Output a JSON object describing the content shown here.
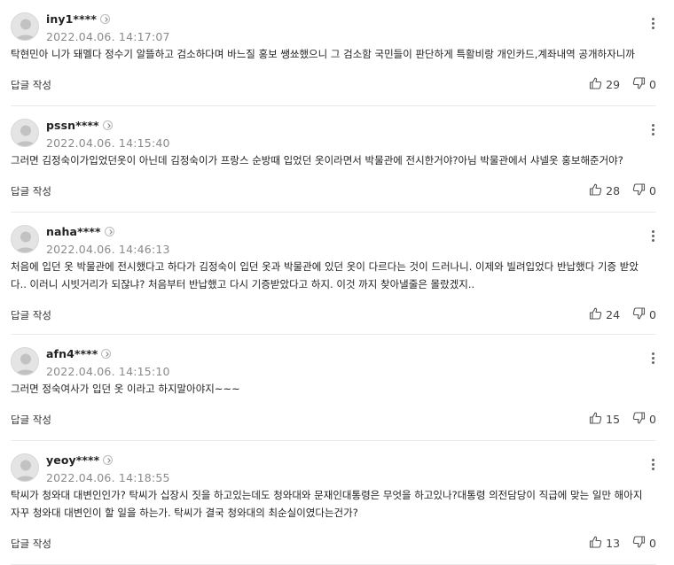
{
  "reply_label": "답글 작성",
  "comments": [
    {
      "user": "iny1****",
      "date": "2022.04.06. 14:17:07",
      "lines": [
        "탁현민아 니가 돼멜다 정수기 알뜰하고 검소하다며 바느질 홍보 쌩쑈했으니 그 검소함 국민들이 판단하게 특활비랑 개인카드,계좌내역 공개하자니까"
      ],
      "likes": "29",
      "dislikes": "0"
    },
    {
      "user": "pssn****",
      "date": "2022.04.06. 14:15:40",
      "lines": [
        "그러면 김정숙이가입었던옷이 아닌데 김정숙이가 프랑스 순방때 입었던 옷이라면서 박물관에 전시한거야?아님 박물관에서 샤넬옷 홍보해준거야?"
      ],
      "likes": "28",
      "dislikes": "0"
    },
    {
      "user": "naha****",
      "date": "2022.04.06. 14:46:13",
      "lines": [
        "처음에 입던 옷 박물관에 전시했다고 하다가 김정숙이 입던 옷과 박물관에 있던 옷이 다르다는 것이 드러나니. 이제와 빌려입었다 반납했다 기증 받았",
        "다.. 이러니 시빗거리가 되잖냐? 처음부터 반납했고 다시 기증받았다고 하지. 이것 까지 찾아낼줄은 몰랐겠지.."
      ],
      "likes": "24",
      "dislikes": "0"
    },
    {
      "user": "afn4****",
      "date": "2022.04.06. 14:15:10",
      "lines": [
        "그러면 정숙여사가 입던 옷 이라고 하지말아야지~~~"
      ],
      "likes": "15",
      "dislikes": "0"
    },
    {
      "user": "yeoy****",
      "date": "2022.04.06. 14:18:55",
      "lines": [
        "탁씨가 청와대 대변인인가? 탁씨가 십장시 짓을 하고있는데도 청와대와 문재인대통령은 무엇을 하고있나?대통령 의전담당이 직급에 맞는 일만 해아지",
        "자꾸 청와대 대변인이 할 일을 하는가. 탁씨가 결국 청와대의 최순실이였다는건가?"
      ],
      "likes": "13",
      "dislikes": "0"
    }
  ]
}
